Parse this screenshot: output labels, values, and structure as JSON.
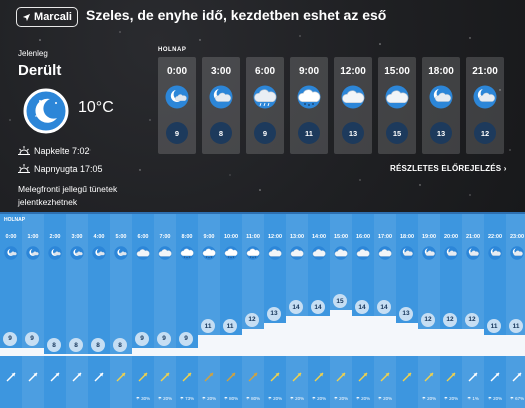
{
  "header": {
    "location_button": "Marcali",
    "headline": "Szeles, de enyhe idő, kezdetben eshet az eső"
  },
  "current": {
    "label": "Jelenleg",
    "condition": "Derült",
    "temperature": "10°C",
    "icon": "night-clear-moon-icon",
    "sunrise": "Napkelte 7:02",
    "sunset": "Napnyugta 17:05",
    "note": "Melegfronti jellegű tünetek jelentkezhetnek"
  },
  "forecast_3h": {
    "day_label": "HOLNAP",
    "columns": [
      {
        "time": "0:00",
        "icon": "moon-small-cloud-icon",
        "value": "9"
      },
      {
        "time": "3:00",
        "icon": "moon-cloud-icon",
        "value": "8"
      },
      {
        "time": "6:00",
        "icon": "cloud-rain-icon",
        "value": "9"
      },
      {
        "time": "9:00",
        "icon": "cloud-light-rain-icon",
        "value": "11"
      },
      {
        "time": "12:00",
        "icon": "overcast-cloud-icon",
        "value": "13"
      },
      {
        "time": "15:00",
        "icon": "overcast-cloud-icon",
        "value": "15"
      },
      {
        "time": "18:00",
        "icon": "moon-cloud-icon",
        "value": "13"
      },
      {
        "time": "21:00",
        "icon": "moon-cloud-icon",
        "value": "12"
      }
    ],
    "details_link": "RÉSZLETES ELŐREJELZÉS"
  },
  "hourly": {
    "day_label": "HOLNAP",
    "hours": [
      {
        "time": "0:00",
        "temp": 9,
        "wind": "light",
        "rain": ""
      },
      {
        "time": "1:00",
        "temp": 9,
        "wind": "light",
        "rain": ""
      },
      {
        "time": "2:00",
        "temp": 8,
        "wind": "light",
        "rain": ""
      },
      {
        "time": "3:00",
        "temp": 8,
        "wind": "light",
        "rain": ""
      },
      {
        "time": "4:00",
        "temp": 8,
        "wind": "light",
        "rain": ""
      },
      {
        "time": "5:00",
        "temp": 8,
        "wind": "strong",
        "rain": ""
      },
      {
        "time": "6:00",
        "temp": 9,
        "wind": "strong",
        "rain": "30%"
      },
      {
        "time": "7:00",
        "temp": 9,
        "wind": "strong",
        "rain": "20%"
      },
      {
        "time": "8:00",
        "temp": 9,
        "wind": "strong",
        "rain": "73%"
      },
      {
        "time": "9:00",
        "temp": 11,
        "wind": "gust",
        "rain": "20%"
      },
      {
        "time": "10:00",
        "temp": 11,
        "wind": "gust",
        "rain": "80%"
      },
      {
        "time": "11:00",
        "temp": 12,
        "wind": "gust",
        "rain": "80%"
      },
      {
        "time": "12:00",
        "temp": 13,
        "wind": "strong",
        "rain": "20%"
      },
      {
        "time": "13:00",
        "temp": 14,
        "wind": "strong",
        "rain": "20%"
      },
      {
        "time": "14:00",
        "temp": 14,
        "wind": "strong",
        "rain": "20%"
      },
      {
        "time": "15:00",
        "temp": 15,
        "wind": "strong",
        "rain": "20%"
      },
      {
        "time": "16:00",
        "temp": 14,
        "wind": "strong",
        "rain": "20%"
      },
      {
        "time": "17:00",
        "temp": 14,
        "wind": "strong",
        "rain": "20%"
      },
      {
        "time": "18:00",
        "temp": 13,
        "wind": "strong",
        "rain": ""
      },
      {
        "time": "19:00",
        "temp": 12,
        "wind": "strong",
        "rain": "20%"
      },
      {
        "time": "20:00",
        "temp": 12,
        "wind": "strong",
        "rain": "20%"
      },
      {
        "time": "21:00",
        "temp": 12,
        "wind": "light",
        "rain": "1%"
      },
      {
        "time": "22:00",
        "temp": 11,
        "wind": "light",
        "rain": "20%"
      },
      {
        "time": "23:00",
        "temp": 11,
        "wind": "light",
        "rain": "67%"
      }
    ]
  },
  "colors": {
    "top_background": "#1f2023",
    "bottom_background": "#3d96df",
    "circle_dark": "#1d3a5c",
    "wind_light": "#ffffff",
    "wind_strong": "#f2d24b",
    "wind_gust": "#d4a23a"
  }
}
